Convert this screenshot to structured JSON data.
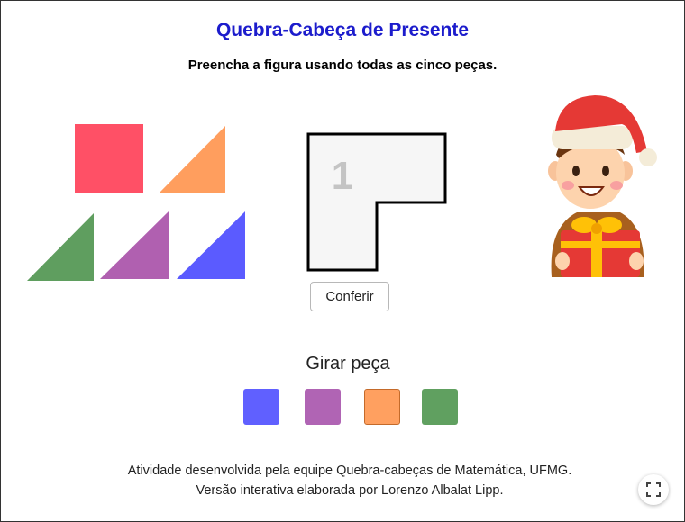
{
  "header": {
    "title": "Quebra-Cabeça de Presente",
    "subtitle": "Preencha a figura usando todas as cinco peças."
  },
  "puzzle": {
    "figure_number": "1",
    "check_button_label": "Conferir"
  },
  "pieces": [
    {
      "name": "square",
      "color": "#ff5066"
    },
    {
      "name": "triangle-orange",
      "color": "#ff9e5e"
    },
    {
      "name": "triangle-green",
      "color": "#5f9e5f"
    },
    {
      "name": "triangle-purple",
      "color": "#b060b0"
    },
    {
      "name": "triangle-blue",
      "color": "#5b5bff"
    }
  ],
  "rotate": {
    "label": "Girar peça",
    "swatches": [
      {
        "name": "blue",
        "color": "#6060ff"
      },
      {
        "name": "purple",
        "color": "#b064b4"
      },
      {
        "name": "orange",
        "color": "#ffa060"
      },
      {
        "name": "green",
        "color": "#60a060"
      }
    ]
  },
  "credits": {
    "line1": "Atividade desenvolvida pela equipe Quebra-cabeças de Matemática, UFMG.",
    "line2": "Versão interativa elaborada por Lorenzo Albalat Lipp."
  },
  "icons": {
    "fullscreen": "fullscreen-icon",
    "character": "santa-boy-gift-illustration"
  }
}
